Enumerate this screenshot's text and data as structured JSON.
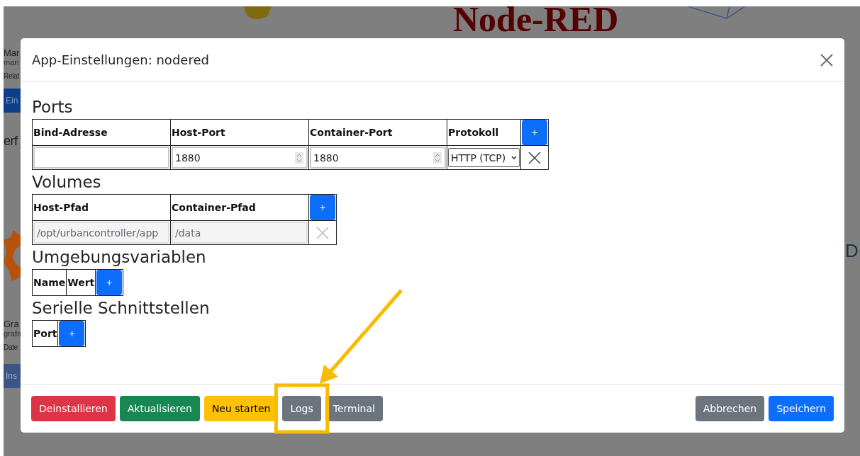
{
  "background": {
    "logo_text": "Node-RED",
    "side_letter": "D",
    "fragments": [
      {
        "kind": "title",
        "text": "Mar"
      },
      {
        "kind": "sub",
        "text": "mari"
      },
      {
        "kind": "meta",
        "text": "Relat"
      },
      {
        "kind": "button",
        "text": "Ein"
      },
      {
        "kind": "heading",
        "text": "erf"
      },
      {
        "kind": "title",
        "text": "Gra"
      },
      {
        "kind": "sub",
        "text": "grafa"
      },
      {
        "kind": "meta",
        "text": "Date"
      },
      {
        "kind": "button",
        "text": "Ins"
      }
    ]
  },
  "modal": {
    "title": "App-Einstellungen: nodered",
    "sections": [
      {
        "heading": "Ports",
        "columns": [
          "Bind-Adresse",
          "Host-Port",
          "Container-Port",
          "Protokoll"
        ],
        "add_label": "+",
        "rows": [
          {
            "disabled": false,
            "cells": [
              {
                "kind": "text"
              },
              {
                "kind": "number",
                "value": "1880"
              },
              {
                "kind": "number",
                "value": "1880"
              },
              {
                "kind": "select",
                "value": "HTTP (TCP)"
              }
            ]
          }
        ]
      },
      {
        "heading": "Volumes",
        "columns": [
          "Host-Pfad",
          "Container-Pfad"
        ],
        "add_label": "+",
        "rows": [
          {
            "disabled": true,
            "cells": [
              {
                "kind": "text",
                "value": "/opt/urbancontroller/app"
              },
              {
                "kind": "text",
                "value": "/data"
              }
            ]
          }
        ]
      },
      {
        "heading": "Umgebungsvariablen",
        "columns": [
          "Name",
          "Wert"
        ],
        "add_label": "+"
      },
      {
        "heading": "Serielle Schnittstellen",
        "columns": [
          "Port"
        ],
        "add_label": "+"
      }
    ],
    "footer": {
      "left_buttons": [
        {
          "label": "Deinstallieren"
        },
        {
          "label": "Aktualisieren"
        },
        {
          "label": "Neu starten"
        },
        {
          "label": "Logs"
        },
        {
          "label": "Terminal"
        }
      ],
      "right_buttons": [
        {
          "label": "Abbrechen"
        },
        {
          "label": "Speichern"
        }
      ]
    }
  }
}
